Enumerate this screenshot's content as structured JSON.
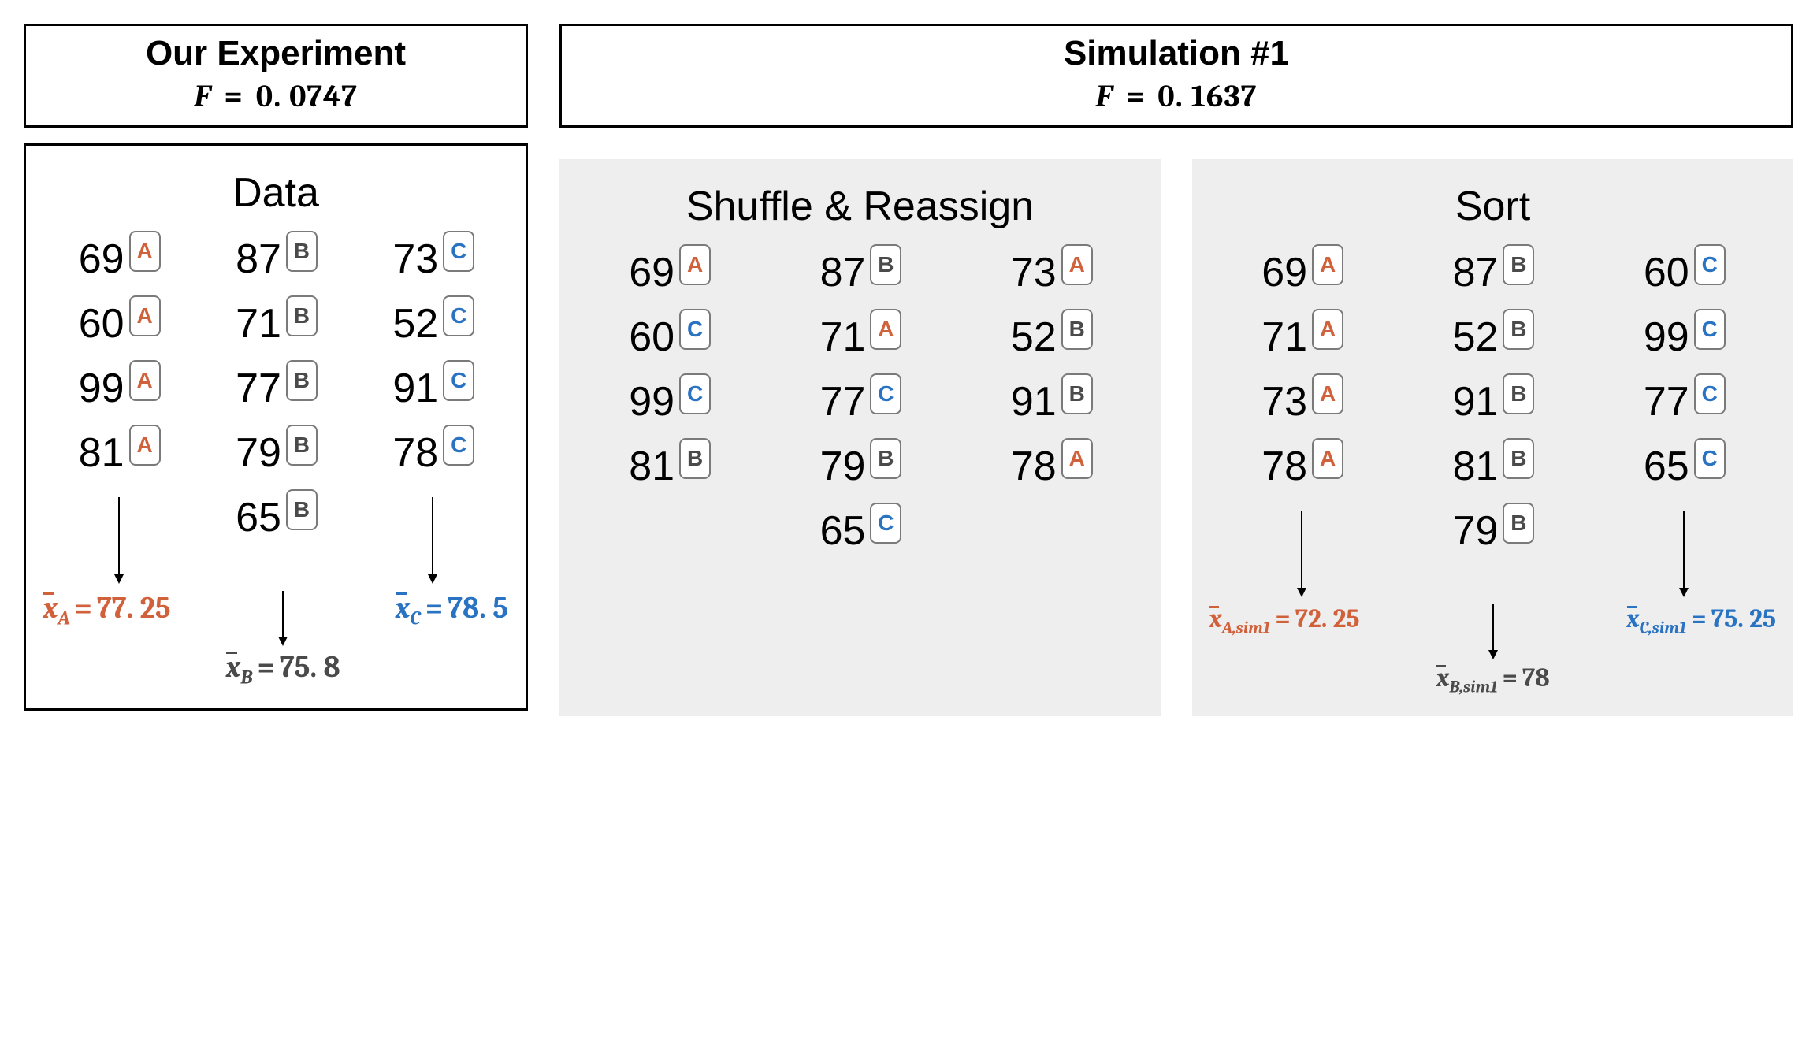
{
  "left": {
    "header_title": "Our Experiment",
    "header_F_label": "F",
    "header_F_value": "0. 0747",
    "panel_title": "Data",
    "columns": [
      {
        "group": "A",
        "values": [
          69,
          60,
          99,
          81
        ]
      },
      {
        "group": "B",
        "values": [
          87,
          71,
          77,
          79,
          65
        ]
      },
      {
        "group": "C",
        "values": [
          73,
          52,
          91,
          78
        ]
      }
    ],
    "means": {
      "A": {
        "label_sub": "A",
        "value": "77. 25"
      },
      "B": {
        "label_sub": "B",
        "value": "75. 8"
      },
      "C": {
        "label_sub": "C",
        "value": "78. 5"
      }
    }
  },
  "right": {
    "header_title": "Simulation #1",
    "header_F_label": "F",
    "header_F_value": "0. 1637",
    "shuffle": {
      "panel_title": "Shuffle & Reassign",
      "columns": [
        [
          {
            "v": 69,
            "g": "A"
          },
          {
            "v": 60,
            "g": "C"
          },
          {
            "v": 99,
            "g": "C"
          },
          {
            "v": 81,
            "g": "B"
          }
        ],
        [
          {
            "v": 87,
            "g": "B"
          },
          {
            "v": 71,
            "g": "A"
          },
          {
            "v": 77,
            "g": "C"
          },
          {
            "v": 79,
            "g": "B"
          },
          {
            "v": 65,
            "g": "C"
          }
        ],
        [
          {
            "v": 73,
            "g": "A"
          },
          {
            "v": 52,
            "g": "B"
          },
          {
            "v": 91,
            "g": "B"
          },
          {
            "v": 78,
            "g": "A"
          }
        ]
      ]
    },
    "sort": {
      "panel_title": "Sort",
      "columns": [
        {
          "group": "A",
          "values": [
            69,
            71,
            73,
            78
          ]
        },
        {
          "group": "B",
          "values": [
            87,
            52,
            91,
            81,
            79
          ]
        },
        {
          "group": "C",
          "values": [
            60,
            99,
            77,
            65
          ]
        }
      ],
      "means": {
        "A": {
          "label_sub": "A,sim1",
          "value": "72. 25"
        },
        "B": {
          "label_sub": "B,sim1",
          "value": "78"
        },
        "C": {
          "label_sub": "C,sim1",
          "value": "75. 25"
        }
      }
    }
  },
  "chart_data": {
    "type": "table",
    "title": "Permutation test illustration for one-way ANOVA F statistic",
    "observed_F": 0.0747,
    "simulation1_F": 0.1637,
    "original_groups": {
      "A": [
        69,
        60,
        99,
        81
      ],
      "B": [
        87,
        71,
        77,
        79,
        65
      ],
      "C": [
        73,
        52,
        91,
        78
      ]
    },
    "original_means": {
      "A": 77.25,
      "B": 75.8,
      "C": 78.5
    },
    "simulation1_reassignment": [
      {
        "value": 69,
        "group": "A"
      },
      {
        "value": 60,
        "group": "C"
      },
      {
        "value": 99,
        "group": "C"
      },
      {
        "value": 81,
        "group": "B"
      },
      {
        "value": 87,
        "group": "B"
      },
      {
        "value": 71,
        "group": "A"
      },
      {
        "value": 77,
        "group": "C"
      },
      {
        "value": 79,
        "group": "B"
      },
      {
        "value": 65,
        "group": "C"
      },
      {
        "value": 73,
        "group": "A"
      },
      {
        "value": 52,
        "group": "B"
      },
      {
        "value": 91,
        "group": "B"
      },
      {
        "value": 78,
        "group": "A"
      }
    ],
    "simulation1_sorted_groups": {
      "A": [
        69,
        71,
        73,
        78
      ],
      "B": [
        87,
        52,
        91,
        81,
        79
      ],
      "C": [
        60,
        99,
        77,
        65
      ]
    },
    "simulation1_means": {
      "A": 72.25,
      "B": 78,
      "C": 75.25
    }
  }
}
